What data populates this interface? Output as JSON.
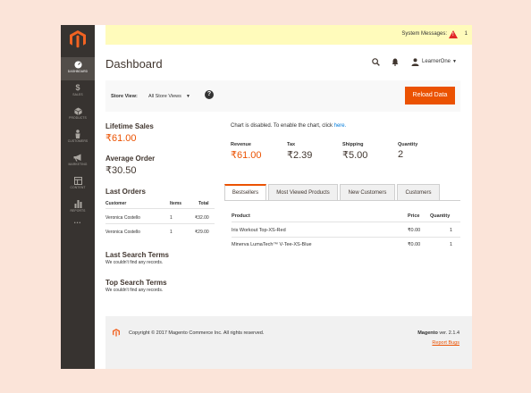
{
  "colors": {
    "accent": "#eb5202",
    "sidebar": "#373330",
    "sysbar": "#fffbbb",
    "link": "#007bdb"
  },
  "sidebar": {
    "logo_icon": "magento-logo-icon",
    "items": [
      {
        "label": "DASHBOARD",
        "icon": "dashboard-icon",
        "active": true
      },
      {
        "label": "SALES",
        "icon": "dollar-icon"
      },
      {
        "label": "PRODUCTS",
        "icon": "cube-icon"
      },
      {
        "label": "CUSTOMERS",
        "icon": "person-icon"
      },
      {
        "label": "MARKETING",
        "icon": "megaphone-icon"
      },
      {
        "label": "CONTENT",
        "icon": "layout-icon"
      },
      {
        "label": "REPORTS",
        "icon": "bar-chart-icon"
      }
    ],
    "more": "•••"
  },
  "system_messages": {
    "label": "System Messages:",
    "count": "1",
    "icon": "warning-icon"
  },
  "header": {
    "title": "Dashboard",
    "username": "LearnerOne"
  },
  "toolbar": {
    "store_view_label": "Store View:",
    "store_view_value": "All Store Views",
    "reload_label": "Reload Data"
  },
  "lifetime_sales": {
    "label": "Lifetime Sales",
    "value": "₹61.00"
  },
  "average_order": {
    "label": "Average Order",
    "value": "₹30.50"
  },
  "last_orders": {
    "title": "Last Orders",
    "headers": [
      "Customer",
      "Items",
      "Total"
    ],
    "rows": [
      [
        "Veronica Costello",
        "1",
        "₹32.00"
      ],
      [
        "Veronica Costello",
        "1",
        "₹29.00"
      ]
    ]
  },
  "last_search_terms": {
    "title": "Last Search Terms",
    "empty": "We couldn't find any records."
  },
  "top_search_terms": {
    "title": "Top Search Terms",
    "empty": "We couldn't find any records."
  },
  "chart": {
    "note_prefix": "Chart is disabled. To enable the chart, click ",
    "link": "here."
  },
  "stats": [
    {
      "label": "Revenue",
      "value": "₹61.00",
      "accent": true
    },
    {
      "label": "Tax",
      "value": "₹2.39"
    },
    {
      "label": "Shipping",
      "value": "₹5.00"
    },
    {
      "label": "Quantity",
      "value": "2"
    }
  ],
  "tabs": [
    {
      "label": "Bestsellers",
      "active": true
    },
    {
      "label": "Most Viewed Products"
    },
    {
      "label": "New Customers"
    },
    {
      "label": "Customers"
    }
  ],
  "bestsellers": {
    "headers": [
      "Product",
      "Price",
      "Quantity"
    ],
    "rows": [
      [
        "Iris Workout Top-XS-Red",
        "₹0.00",
        "1"
      ],
      [
        "Minerva LumaTech™ V-Tee-XS-Blue",
        "₹0.00",
        "1"
      ]
    ]
  },
  "footer": {
    "copyright": "Copyright © 2017 Magento Commerce Inc. All rights reserved.",
    "version_brand": "Magento",
    "version": " ver. 2.1.4",
    "report_bugs": "Report Bugs"
  }
}
